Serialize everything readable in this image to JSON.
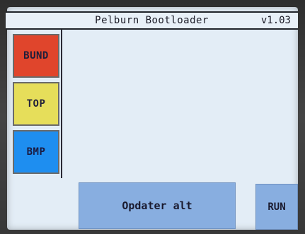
{
  "header": {
    "title": "Pelburn Bootloader",
    "version": "v1.03"
  },
  "sidebar": {
    "items": [
      {
        "label": "BUND",
        "color": "#e0452c"
      },
      {
        "label": "TOP",
        "color": "#e6de5a"
      },
      {
        "label": "BMP",
        "color": "#1e8ef0"
      }
    ]
  },
  "footer": {
    "update_label": "Opdater alt",
    "run_label": "RUN",
    "button_color": "#88aee0"
  },
  "colors": {
    "screen_background": "#e3edf6"
  }
}
